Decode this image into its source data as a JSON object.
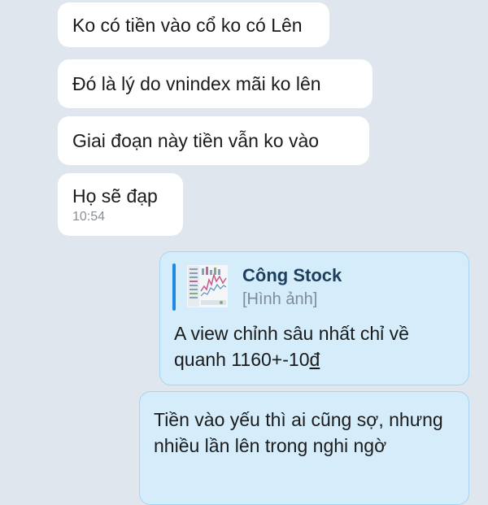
{
  "messages": {
    "m1": {
      "text": "Ko có tiền vào cổ ko có Lên"
    },
    "m2": {
      "text": "Đó là lý do vnindex mãi ko lên"
    },
    "m3": {
      "text": "Giai đoạn này tiền vẫn ko vào"
    },
    "m4": {
      "text": "Họ sẽ đạp",
      "time": "10:54"
    },
    "m5": {
      "quote": {
        "sender": "Công Stock",
        "type": "[Hình ảnh]",
        "thumbnail_icon": "chart-thumbnail-icon"
      },
      "text_main": "A view chỉnh sâu nhất chỉ về quanh 1160+-10",
      "text_suffix": "đ"
    },
    "m6": {
      "text": "Tiền vào yếu thì ai cũng sợ, nhưng nhiều lần lên trong nghi ngờ"
    }
  },
  "colors": {
    "background": "#dfe6ee",
    "incoming_bubble": "#ffffff",
    "outgoing_bubble": "#d5ecfb",
    "quote_bar": "#1e88e5",
    "timestamp": "#8a8f96"
  }
}
